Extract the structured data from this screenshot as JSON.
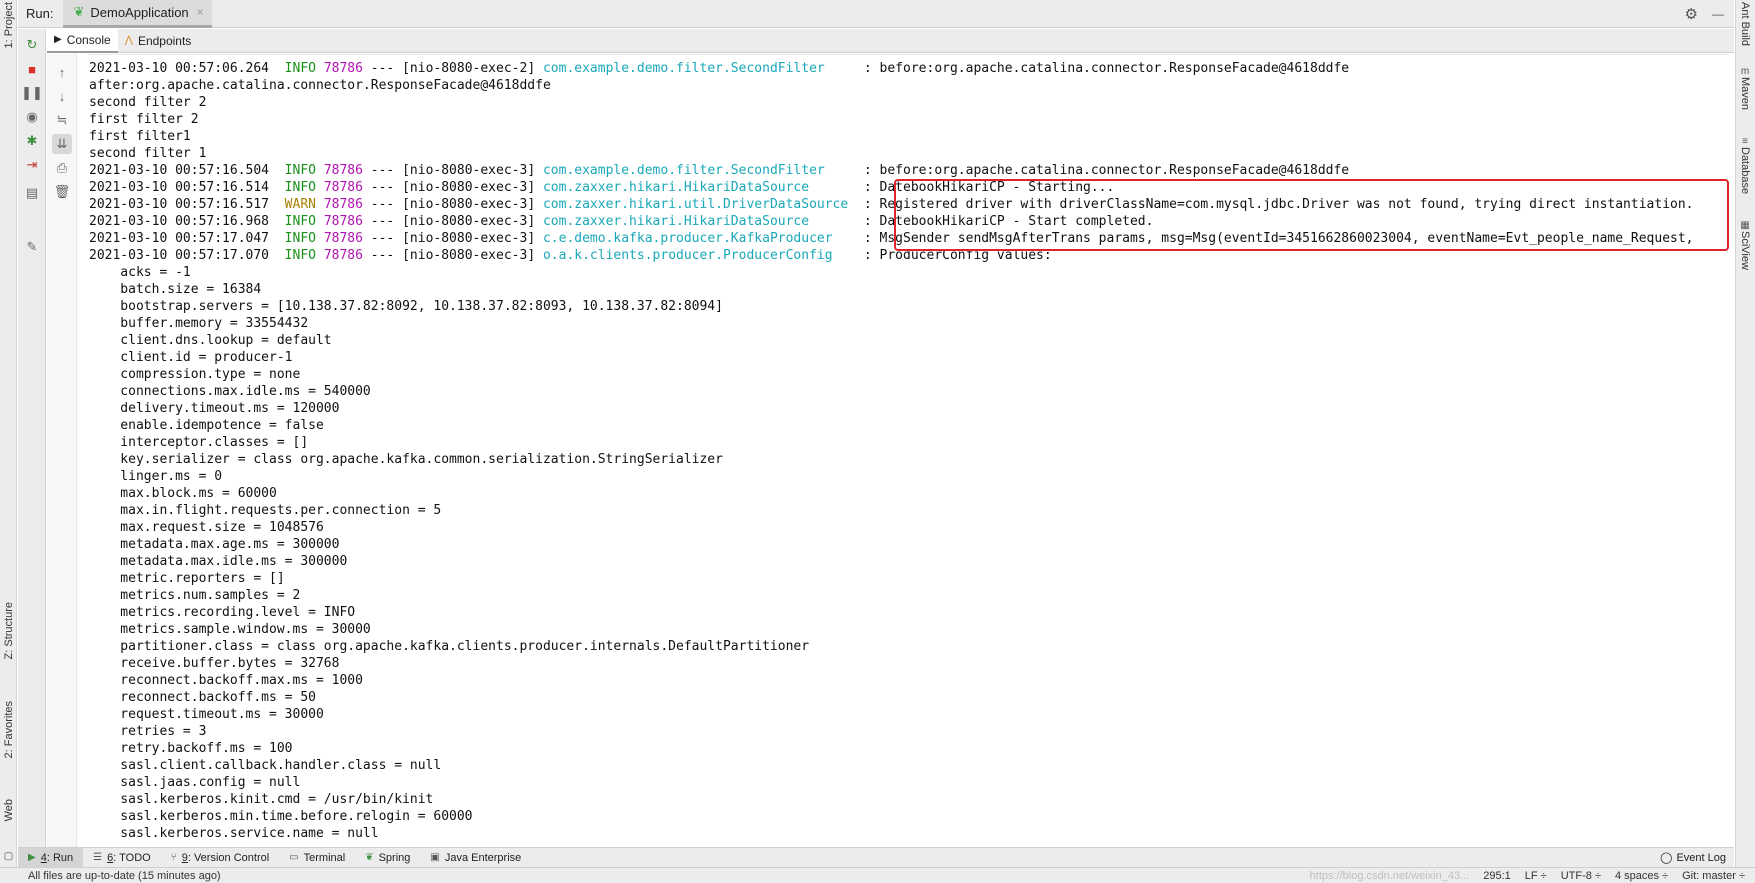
{
  "run_header": {
    "run_label": "Run:",
    "tab_title": "DemoApplication",
    "tab_close": "×",
    "settings_icon": "⚙",
    "minimize_icon": "—"
  },
  "subtabs": {
    "console": "Console",
    "endpoints": "Endpoints"
  },
  "left_stripe": {
    "project": "1: Project",
    "structure": "Z: Structure",
    "favorites": "2: Favorites",
    "web": "Web"
  },
  "right_stripe": {
    "ant_build": "Ant Build",
    "maven": "Maven",
    "database": "Database",
    "sciview": "SciView"
  },
  "console": {
    "log_lines": [
      {
        "ts": "2021-03-10 00:57:06.264",
        "level": "INFO",
        "pid": "78786",
        "thread": "[nio-8080-exec-2]",
        "logger": "com.example.demo.filter.SecondFilter",
        "msg": "before:org.apache.catalina.connector.ResponseFacade@4618ddfe"
      }
    ],
    "plain_lines_1": [
      "after:org.apache.catalina.connector.ResponseFacade@4618ddfe",
      "second filter 2",
      "first filter 2",
      "first filter1",
      "second filter 1"
    ],
    "log_lines_2": [
      {
        "ts": "2021-03-10 00:57:16.504",
        "level": "INFO",
        "pid": "78786",
        "thread": "[nio-8080-exec-3]",
        "logger": "com.example.demo.filter.SecondFilter",
        "msg": "before:org.apache.catalina.connector.ResponseFacade@4618ddfe"
      },
      {
        "ts": "2021-03-10 00:57:16.514",
        "level": "INFO",
        "pid": "78786",
        "thread": "[nio-8080-exec-3]",
        "logger": "com.zaxxer.hikari.HikariDataSource",
        "msg": "DatebookHikariCP - Starting..."
      },
      {
        "ts": "2021-03-10 00:57:16.517",
        "level": "WARN",
        "pid": "78786",
        "thread": "[nio-8080-exec-3]",
        "logger": "com.zaxxer.hikari.util.DriverDataSource",
        "msg": "Registered driver with driverClassName=com.mysql.jdbc.Driver was not found, trying direct instantiation."
      },
      {
        "ts": "2021-03-10 00:57:16.968",
        "level": "INFO",
        "pid": "78786",
        "thread": "[nio-8080-exec-3]",
        "logger": "com.zaxxer.hikari.HikariDataSource",
        "msg": "DatebookHikariCP - Start completed."
      },
      {
        "ts": "2021-03-10 00:57:17.047",
        "level": "INFO",
        "pid": "78786",
        "thread": "[nio-8080-exec-3]",
        "logger": "c.e.demo.kafka.producer.KafkaProducer",
        "msg": "MsgSender sendMsgAfterTrans params, msg=Msg(eventId=3451662860023004, eventName=Evt_people_name_Request,"
      },
      {
        "ts": "2021-03-10 00:57:17.070",
        "level": "INFO",
        "pid": "78786",
        "thread": "[nio-8080-exec-3]",
        "logger": "o.a.k.clients.producer.ProducerConfig",
        "msg": "ProducerConfig values:"
      }
    ],
    "config_lines": [
      "acks = -1",
      "batch.size = 16384",
      "bootstrap.servers = [10.138.37.82:8092, 10.138.37.82:8093, 10.138.37.82:8094]",
      "buffer.memory = 33554432",
      "client.dns.lookup = default",
      "client.id = producer-1",
      "compression.type = none",
      "connections.max.idle.ms = 540000",
      "delivery.timeout.ms = 120000",
      "enable.idempotence = false",
      "interceptor.classes = []",
      "key.serializer = class org.apache.kafka.common.serialization.StringSerializer",
      "linger.ms = 0",
      "max.block.ms = 60000",
      "max.in.flight.requests.per.connection = 5",
      "max.request.size = 1048576",
      "metadata.max.age.ms = 300000",
      "metadata.max.idle.ms = 300000",
      "metric.reporters = []",
      "metrics.num.samples = 2",
      "metrics.recording.level = INFO",
      "metrics.sample.window.ms = 30000",
      "partitioner.class = class org.apache.kafka.clients.producer.internals.DefaultPartitioner",
      "receive.buffer.bytes = 32768",
      "reconnect.backoff.max.ms = 1000",
      "reconnect.backoff.ms = 50",
      "request.timeout.ms = 30000",
      "retries = 3",
      "retry.backoff.ms = 100",
      "sasl.client.callback.handler.class = null",
      "sasl.jaas.config = null",
      "sasl.kerberos.kinit.cmd = /usr/bin/kinit",
      "sasl.kerberos.min.time.before.relogin = 60000",
      "sasl.kerberos.service.name = null"
    ],
    "level_colors": {
      "INFO": "#1a8f1a",
      "WARN": "#a38200"
    },
    "highlight_color": "#e0242a"
  },
  "bottom_tabs": [
    {
      "num": "4",
      "label": ": Run",
      "icon": "play-icon"
    },
    {
      "num": "6",
      "label": ": TODO",
      "icon": "list-icon"
    },
    {
      "num": "9",
      "label": ": Version Control",
      "icon": "branch-icon"
    },
    {
      "num": "",
      "label": "Terminal",
      "icon": "terminal-icon"
    },
    {
      "num": "",
      "label": "Spring",
      "icon": "spring-icon"
    },
    {
      "num": "",
      "label": "Java Enterprise",
      "icon": "enterprise-icon"
    }
  ],
  "event_log": "Event Log",
  "status_bar": {
    "message": "All files are up-to-date (15 minutes ago)",
    "position": "295:1",
    "line_sep": "LF ÷",
    "encoding": "UTF-8 ÷",
    "indent": "4 spaces ÷",
    "git": "Git: master ÷",
    "watermark": "https://blog.csdn.net/weixin_43..."
  }
}
